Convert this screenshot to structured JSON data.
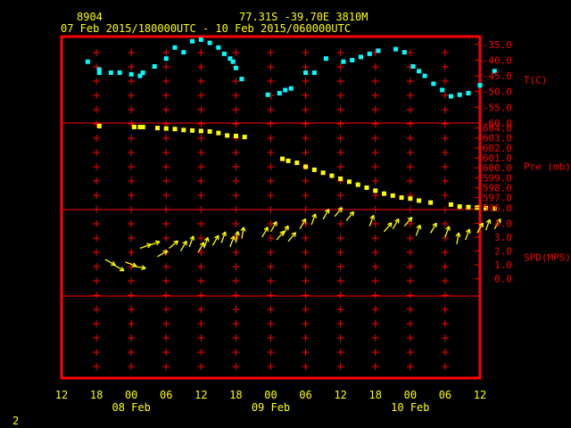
{
  "header": {
    "station_id": "8904",
    "location": "77.31S  -39.70E  3810M",
    "time_range": "07 Feb 2015/180000UTC - 10 Feb 2015/060000UTC"
  },
  "footer": {
    "page_number": "2"
  },
  "colors": {
    "background": "#000000",
    "frame": "#ff0000",
    "header_text": "#ffff00",
    "axis_text": "#ffff00",
    "temp": "#00ffff",
    "pressure": "#ffff00",
    "wind": "#ffff00"
  },
  "chart_data": {
    "type": "scatter",
    "time_axis": {
      "ticks": [
        "12",
        "18",
        "00",
        "06",
        "12",
        "18",
        "00",
        "06",
        "12",
        "18",
        "00",
        "06",
        "12"
      ],
      "day_labels": [
        {
          "label": "08 Feb",
          "under_tick": 2
        },
        {
          "label": "09 Feb",
          "under_tick": 6
        },
        {
          "label": "10 Feb",
          "under_tick": 10
        }
      ],
      "range_hours": [
        -12,
        60
      ]
    },
    "panels": [
      {
        "name": "temperature",
        "ylabel": "T(C)",
        "ylim": [
          -60,
          -32.5
        ],
        "tick_labels": [
          "-35.0",
          "-40.0",
          "-45.0",
          "-50.0",
          "-55.0",
          "-60.0"
        ],
        "tick_values": [
          -35,
          -40,
          -45,
          -50,
          -55,
          -60
        ],
        "points": [
          {
            "x": -7.5,
            "y": -40.5
          },
          {
            "x": -5.5,
            "y": -43.0
          },
          {
            "x": -5.5,
            "y": -44.0
          },
          {
            "x": -3.5,
            "y": -44.0
          },
          {
            "x": -2.0,
            "y": -44.0
          },
          {
            "x": 0.0,
            "y": -44.5
          },
          {
            "x": 1.5,
            "y": -45.0
          },
          {
            "x": 2.0,
            "y": -44.0
          },
          {
            "x": 4.0,
            "y": -42.0
          },
          {
            "x": 6.0,
            "y": -39.5
          },
          {
            "x": 7.5,
            "y": -36.0
          },
          {
            "x": 9.0,
            "y": -37.5
          },
          {
            "x": 10.5,
            "y": -34.0
          },
          {
            "x": 12.0,
            "y": -33.5
          },
          {
            "x": 13.5,
            "y": -34.5
          },
          {
            "x": 15.0,
            "y": -36.0
          },
          {
            "x": 16.0,
            "y": -38.0
          },
          {
            "x": 17.0,
            "y": -39.5
          },
          {
            "x": 17.5,
            "y": -40.5
          },
          {
            "x": 18.0,
            "y": -42.5
          },
          {
            "x": 19.0,
            "y": -46.0
          },
          {
            "x": 23.5,
            "y": -51.0
          },
          {
            "x": 25.5,
            "y": -50.5
          },
          {
            "x": 26.5,
            "y": -49.5
          },
          {
            "x": 27.5,
            "y": -49.0
          },
          {
            "x": 30.0,
            "y": -44.0
          },
          {
            "x": 31.5,
            "y": -44.0
          },
          {
            "x": 33.5,
            "y": -39.5
          },
          {
            "x": 36.5,
            "y": -40.5
          },
          {
            "x": 38.0,
            "y": -40.0
          },
          {
            "x": 39.5,
            "y": -39.0
          },
          {
            "x": 41.0,
            "y": -38.0
          },
          {
            "x": 42.5,
            "y": -37.0
          },
          {
            "x": 45.5,
            "y": -36.5
          },
          {
            "x": 47.0,
            "y": -37.5
          },
          {
            "x": 48.5,
            "y": -42.0
          },
          {
            "x": 49.5,
            "y": -43.5
          },
          {
            "x": 50.5,
            "y": -45.0
          },
          {
            "x": 52.0,
            "y": -47.5
          },
          {
            "x": 53.5,
            "y": -49.5
          },
          {
            "x": 55.0,
            "y": -51.5
          },
          {
            "x": 56.5,
            "y": -51.0
          },
          {
            "x": 58.0,
            "y": -50.5
          },
          {
            "x": 60.0,
            "y": -48.0
          },
          {
            "x": 62.5,
            "y": -43.5
          }
        ]
      },
      {
        "name": "pressure",
        "ylabel": "Pre (mb)",
        "ylim": [
          595.8,
          604.5
        ],
        "tick_labels": [
          "604.0",
          "603.0",
          "602.0",
          "601.0",
          "600.0",
          "599.0",
          "598.0",
          "597.0",
          "596.0"
        ],
        "tick_values": [
          604,
          603,
          602,
          601,
          600,
          599,
          598,
          597,
          596
        ],
        "points": [
          {
            "x": -5.5,
            "y": 604.2
          },
          {
            "x": 0.5,
            "y": 604.1
          },
          {
            "x": 1.5,
            "y": 604.1
          },
          {
            "x": 2.0,
            "y": 604.1
          },
          {
            "x": 4.5,
            "y": 604.0
          },
          {
            "x": 6.0,
            "y": 603.95
          },
          {
            "x": 7.5,
            "y": 603.9
          },
          {
            "x": 9.0,
            "y": 603.8
          },
          {
            "x": 10.5,
            "y": 603.75
          },
          {
            "x": 12.0,
            "y": 603.7
          },
          {
            "x": 13.5,
            "y": 603.65
          },
          {
            "x": 15.0,
            "y": 603.5
          },
          {
            "x": 16.5,
            "y": 603.25
          },
          {
            "x": 18.0,
            "y": 603.2
          },
          {
            "x": 19.5,
            "y": 603.1
          },
          {
            "x": 26.0,
            "y": 600.9
          },
          {
            "x": 27.0,
            "y": 600.7
          },
          {
            "x": 28.5,
            "y": 600.5
          },
          {
            "x": 30.0,
            "y": 600.1
          },
          {
            "x": 31.5,
            "y": 599.8
          },
          {
            "x": 33.0,
            "y": 599.5
          },
          {
            "x": 34.5,
            "y": 599.2
          },
          {
            "x": 36.0,
            "y": 598.9
          },
          {
            "x": 37.5,
            "y": 598.6
          },
          {
            "x": 39.0,
            "y": 598.3
          },
          {
            "x": 40.5,
            "y": 598.0
          },
          {
            "x": 42.0,
            "y": 597.7
          },
          {
            "x": 43.5,
            "y": 597.4
          },
          {
            "x": 45.0,
            "y": 597.2
          },
          {
            "x": 46.5,
            "y": 597.0
          },
          {
            "x": 48.0,
            "y": 596.9
          },
          {
            "x": 49.5,
            "y": 596.7
          },
          {
            "x": 51.5,
            "y": 596.5
          },
          {
            "x": 55.0,
            "y": 596.3
          },
          {
            "x": 56.5,
            "y": 596.1
          },
          {
            "x": 58.0,
            "y": 596.05
          },
          {
            "x": 59.5,
            "y": 596.0
          },
          {
            "x": 61.0,
            "y": 595.95
          },
          {
            "x": 62.5,
            "y": 595.9
          }
        ]
      },
      {
        "name": "wind_speed",
        "ylabel": "SPD(MPS)",
        "ylim": [
          -1.25,
          5.0
        ],
        "tick_labels": [
          "4.0",
          "3.0",
          "2.0",
          "1.0",
          "0.0"
        ],
        "tick_values": [
          4,
          3,
          2,
          1,
          0
        ],
        "points": [
          {
            "x": -4.5,
            "y": 1.4,
            "dir": 300
          },
          {
            "x": -3.0,
            "y": 1.0,
            "dir": 300
          },
          {
            "x": -1.0,
            "y": 1.2,
            "dir": 290
          },
          {
            "x": 0.5,
            "y": 0.9,
            "dir": 280
          },
          {
            "x": 1.5,
            "y": 2.2,
            "dir": 250
          },
          {
            "x": 3.0,
            "y": 2.4,
            "dir": 250
          },
          {
            "x": 4.5,
            "y": 1.6,
            "dir": 240
          },
          {
            "x": 6.5,
            "y": 2.2,
            "dir": 230
          },
          {
            "x": 8.5,
            "y": 2.0,
            "dir": 210
          },
          {
            "x": 10.0,
            "y": 2.3,
            "dir": 200
          },
          {
            "x": 11.5,
            "y": 1.9,
            "dir": 210
          },
          {
            "x": 12.5,
            "y": 2.2,
            "dir": 200
          },
          {
            "x": 14.0,
            "y": 2.4,
            "dir": 210
          },
          {
            "x": 15.5,
            "y": 2.6,
            "dir": 200
          },
          {
            "x": 17.0,
            "y": 2.3,
            "dir": 200
          },
          {
            "x": 18.0,
            "y": 2.6,
            "dir": 190
          },
          {
            "x": 19.0,
            "y": 2.9,
            "dir": 190
          },
          {
            "x": 22.5,
            "y": 3.0,
            "dir": 210
          },
          {
            "x": 24.0,
            "y": 3.4,
            "dir": 210
          },
          {
            "x": 25.0,
            "y": 2.8,
            "dir": 220
          },
          {
            "x": 26.0,
            "y": 3.1,
            "dir": 210
          },
          {
            "x": 27.0,
            "y": 2.7,
            "dir": 220
          },
          {
            "x": 29.0,
            "y": 3.6,
            "dir": 210
          },
          {
            "x": 31.0,
            "y": 3.9,
            "dir": 200
          },
          {
            "x": 33.0,
            "y": 4.3,
            "dir": 210
          },
          {
            "x": 35.0,
            "y": 4.5,
            "dir": 220
          },
          {
            "x": 37.0,
            "y": 4.2,
            "dir": 220
          },
          {
            "x": 41.0,
            "y": 3.8,
            "dir": 200
          },
          {
            "x": 43.5,
            "y": 3.4,
            "dir": 220
          },
          {
            "x": 45.0,
            "y": 3.6,
            "dir": 210
          },
          {
            "x": 47.0,
            "y": 3.8,
            "dir": 220
          },
          {
            "x": 49.0,
            "y": 3.1,
            "dir": 200
          },
          {
            "x": 51.5,
            "y": 3.3,
            "dir": 210
          },
          {
            "x": 54.0,
            "y": 3.0,
            "dir": 200
          },
          {
            "x": 56.0,
            "y": 2.5,
            "dir": 190
          },
          {
            "x": 57.5,
            "y": 2.8,
            "dir": 200
          },
          {
            "x": 59.5,
            "y": 3.3,
            "dir": 210
          },
          {
            "x": 61.0,
            "y": 3.5,
            "dir": 200
          },
          {
            "x": 62.5,
            "y": 3.6,
            "dir": 210
          }
        ]
      }
    ],
    "grid": true
  }
}
